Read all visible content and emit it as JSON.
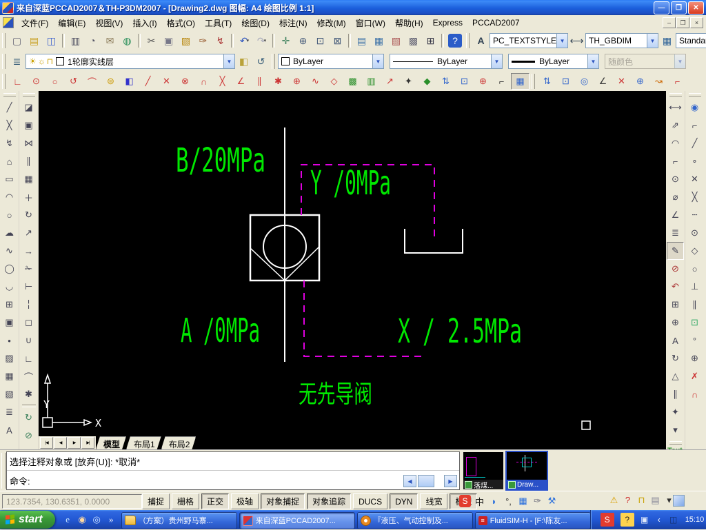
{
  "colors": {
    "cad_green": "#00e800",
    "cad_magenta": "#e000e0",
    "cad_white": "#ffffff",
    "selection_blue": "#2a50c8"
  },
  "title_bar": {
    "title": "来自深蓝PCCAD2007＆TH-P3DM2007 - [Drawing2.dwg 图幅: A4 绘图比例 1:1]",
    "minimize": "—",
    "restore": "❐",
    "close": "✕"
  },
  "menu_bar": {
    "items": [
      {
        "n": "menu-file",
        "t": "文件(F)"
      },
      {
        "n": "menu-edit",
        "t": "编辑(E)"
      },
      {
        "n": "menu-view",
        "t": "视图(V)"
      },
      {
        "n": "menu-insert",
        "t": "插入(I)"
      },
      {
        "n": "menu-format",
        "t": "格式(O)"
      },
      {
        "n": "menu-tools",
        "t": "工具(T)"
      },
      {
        "n": "menu-draw",
        "t": "绘图(D)"
      },
      {
        "n": "menu-dimension",
        "t": "标注(N)"
      },
      {
        "n": "menu-modify",
        "t": "修改(M)"
      },
      {
        "n": "menu-window",
        "t": "窗口(W)"
      },
      {
        "n": "menu-help",
        "t": "帮助(H)"
      },
      {
        "n": "menu-express",
        "t": "Express"
      },
      {
        "n": "menu-pccad",
        "t": "PCCAD2007"
      }
    ],
    "minimize": "–",
    "restore": "❐",
    "close": "×"
  },
  "toolbars": {
    "standard": {
      "items": [
        {
          "n": "new-icon",
          "g": "▢",
          "c": "#667"
        },
        {
          "n": "open-icon",
          "g": "▤",
          "c": "#c9a227"
        },
        {
          "n": "save-icon",
          "g": "◫",
          "c": "#3a5fcd"
        },
        {
          "sep": 1
        },
        {
          "n": "plot-icon",
          "g": "▥",
          "c": "#556"
        },
        {
          "n": "plot-preview-icon",
          "g": "◔",
          "c": "#556"
        },
        {
          "n": "publish-icon",
          "g": "✉",
          "c": "#887755"
        },
        {
          "n": "web-icon",
          "g": "◍",
          "c": "#2a8f5a"
        },
        {
          "sep": 1
        },
        {
          "n": "cut-icon",
          "g": "✂",
          "c": "#555"
        },
        {
          "n": "copy-icon",
          "g": "▣",
          "c": "#778"
        },
        {
          "n": "paste-icon",
          "g": "▨",
          "c": "#b8860b"
        },
        {
          "n": "match-properties-icon",
          "g": "✑",
          "c": "#96592d"
        },
        {
          "n": "block-editor-icon",
          "g": "↯",
          "c": "#a33"
        },
        {
          "sep": 1
        },
        {
          "n": "undo-icon",
          "g": "↶",
          "c": "#2a52be",
          "dd": 1
        },
        {
          "n": "redo-icon",
          "g": "↷",
          "c": "#a8aabb",
          "dd": 1
        },
        {
          "sep": 1
        },
        {
          "n": "pan-icon",
          "g": "✛",
          "c": "#3a7f5a"
        },
        {
          "n": "zoom-realtime-icon",
          "g": "⊕",
          "c": "#445a7a"
        },
        {
          "n": "zoom-window-icon",
          "g": "⊡",
          "c": "#445a7a"
        },
        {
          "n": "zoom-previous-icon",
          "g": "⊠",
          "c": "#445a7a"
        },
        {
          "sep": 1
        },
        {
          "n": "properties-icon",
          "g": "▤",
          "c": "#4477aa"
        },
        {
          "n": "sheet-set-icon",
          "g": "▦",
          "c": "#4477aa"
        },
        {
          "n": "markup-icon",
          "g": "▧",
          "c": "#aa5555"
        },
        {
          "n": "render-icon",
          "g": "▩",
          "c": "#667"
        },
        {
          "n": "calculator-icon",
          "g": "⊞",
          "c": "#334"
        },
        {
          "sep": 1
        },
        {
          "n": "help-icon",
          "g": "?",
          "c": "#fff",
          "bg": "#2b5cc8"
        }
      ],
      "text_style_icon": "A",
      "text_style": "PC_TEXTSTYLE",
      "dim_style_icon": "⟷",
      "dim_style": "TH_GBDIM",
      "table_style_icon": "▦",
      "table_style": "Standard"
    },
    "layers": {
      "manager": [
        {
          "n": "layer-manager-icon",
          "g": "≣",
          "c": "#335a77"
        }
      ],
      "bulb_icon": "☀",
      "freeze_icon": "☼",
      "lock_icon": "⊓",
      "layer_name": "1轮廓实线层",
      "right": [
        {
          "n": "make-object-layer-icon",
          "g": "◧",
          "c": "#b9a23a"
        },
        {
          "n": "layer-previous-icon",
          "g": "↺",
          "c": "#335a77"
        }
      ]
    },
    "properties": {
      "color": "ByLayer",
      "linetype": "ByLayer",
      "lineweight": "ByLayer",
      "plot_style": "随颜色"
    },
    "custom": {
      "group1": [
        {
          "n": "pccad-tool-1-icon",
          "g": "∟",
          "c": "#c33"
        },
        {
          "n": "pccad-tool-2-icon",
          "g": "⊙",
          "c": "#c33"
        },
        {
          "n": "pccad-tool-3-icon",
          "g": "○",
          "c": "#c33"
        },
        {
          "n": "pccad-tool-4-icon",
          "g": "↺",
          "c": "#c33"
        },
        {
          "n": "pccad-tool-5-icon",
          "g": "⌒",
          "c": "#c33"
        },
        {
          "n": "pccad-tool-6-icon",
          "g": "⊜",
          "c": "#cc9900"
        },
        {
          "n": "pccad-tool-7-icon",
          "g": "◧",
          "c": "#3333cc"
        },
        {
          "n": "pccad-tool-8-icon",
          "g": "╱",
          "c": "#c33"
        },
        {
          "n": "pccad-tool-9-icon",
          "g": "✕",
          "c": "#c33"
        },
        {
          "n": "pccad-tool-10-icon",
          "g": "⊗",
          "c": "#c33"
        },
        {
          "n": "pccad-tool-11-icon",
          "g": "∩",
          "c": "#c33"
        },
        {
          "n": "pccad-tool-12-icon",
          "g": "╳",
          "c": "#c33"
        },
        {
          "n": "pccad-tool-13-icon",
          "g": "∠",
          "c": "#c33"
        },
        {
          "n": "pccad-tool-14-icon",
          "g": "∥",
          "c": "#c33"
        },
        {
          "n": "pccad-tool-15-icon",
          "g": "✱",
          "c": "#c33"
        },
        {
          "n": "pccad-tool-16-icon",
          "g": "⊕",
          "c": "#c33"
        },
        {
          "n": "pccad-tool-17-icon",
          "g": "∿",
          "c": "#c33"
        },
        {
          "n": "pccad-tool-18-icon",
          "g": "◇",
          "c": "#c33"
        }
      ],
      "group2": [
        {
          "n": "pccad-tool-19-icon",
          "g": "▩",
          "c": "#2a8f2a"
        },
        {
          "n": "pccad-tool-20-icon",
          "g": "▥",
          "c": "#2a8f2a"
        },
        {
          "n": "pccad-tool-21-icon",
          "g": "↗",
          "c": "#c33"
        },
        {
          "n": "pccad-tool-22-icon",
          "g": "✦",
          "c": "#333"
        },
        {
          "n": "pccad-tool-23-icon",
          "g": "◆",
          "c": "#2a8f2a"
        },
        {
          "n": "pccad-tool-24-icon",
          "g": "⇅",
          "c": "#36c"
        },
        {
          "n": "pccad-tool-25-icon",
          "g": "⊡",
          "c": "#36c"
        },
        {
          "n": "pccad-tool-26-icon",
          "g": "⊕",
          "c": "#c33"
        },
        {
          "n": "pccad-tool-27-icon",
          "g": "⌐",
          "c": "#333"
        },
        {
          "n": "pccad-tool-28-icon",
          "g": "▦",
          "c": "#36c",
          "pressed": 1
        }
      ],
      "group3": [
        {
          "n": "pccad-tool-29-icon",
          "g": "⇅",
          "c": "#36c"
        },
        {
          "n": "pccad-tool-30-icon",
          "g": "⊡",
          "c": "#36c"
        },
        {
          "n": "pccad-tool-31-icon",
          "g": "◎",
          "c": "#36c"
        },
        {
          "n": "pccad-tool-32-icon",
          "g": "∠",
          "c": "#333"
        },
        {
          "n": "pccad-tool-33-icon",
          "g": "✕",
          "c": "#c33"
        },
        {
          "n": "pccad-tool-34-icon",
          "g": "⊕",
          "c": "#36c"
        },
        {
          "n": "pccad-tool-35-icon",
          "g": "↝",
          "c": "#c60"
        },
        {
          "n": "pccad-tool-36-icon",
          "g": "⌐",
          "c": "#c33"
        }
      ]
    },
    "draw": {
      "items": [
        {
          "n": "line-icon",
          "g": "╱"
        },
        {
          "n": "construction-line-icon",
          "g": "╳"
        },
        {
          "n": "polyline-icon",
          "g": "↯"
        },
        {
          "n": "polygon-icon",
          "g": "⌂"
        },
        {
          "n": "rectangle-icon",
          "g": "▭"
        },
        {
          "n": "arc-icon",
          "g": "◠"
        },
        {
          "n": "circle-icon",
          "g": "○"
        },
        {
          "n": "revision-cloud-icon",
          "g": "☁"
        },
        {
          "n": "spline-icon",
          "g": "∿"
        },
        {
          "n": "ellipse-icon",
          "g": "◯"
        },
        {
          "n": "ellipse-arc-icon",
          "g": "◡"
        },
        {
          "n": "insert-block-icon",
          "g": "⊞"
        },
        {
          "n": "make-block-icon",
          "g": "▣"
        },
        {
          "n": "point-icon",
          "g": "•"
        },
        {
          "n": "hatch-icon",
          "g": "▨"
        },
        {
          "n": "gradient-icon",
          "g": "▦"
        },
        {
          "n": "region-icon",
          "g": "▧"
        },
        {
          "n": "table-icon",
          "g": "≣"
        },
        {
          "n": "multiline-text-icon",
          "g": "A"
        }
      ]
    },
    "modify": {
      "items": [
        {
          "n": "erase-icon",
          "g": "◪"
        },
        {
          "n": "copy-object-icon",
          "g": "▣"
        },
        {
          "n": "mirror-icon",
          "g": "⋈"
        },
        {
          "n": "offset-icon",
          "g": "∥"
        },
        {
          "n": "array-icon",
          "g": "▦"
        },
        {
          "n": "move-icon",
          "g": "＋"
        },
        {
          "n": "rotate-icon",
          "g": "↻"
        },
        {
          "n": "scale-icon",
          "g": "↗"
        },
        {
          "n": "stretch-icon",
          "g": "→"
        },
        {
          "n": "trim-icon",
          "g": "✁"
        },
        {
          "n": "extend-icon",
          "g": "⊢"
        },
        {
          "n": "break-point-icon",
          "g": "╎"
        },
        {
          "n": "break-icon",
          "g": "◻"
        },
        {
          "n": "join-icon",
          "g": "∪"
        },
        {
          "n": "chamfer-icon",
          "g": "∟"
        },
        {
          "n": "fillet-icon",
          "g": "⌒"
        },
        {
          "n": "explode-icon",
          "g": "✱"
        },
        {
          "sep": 1
        },
        {
          "n": "orbit-icon",
          "g": "↻",
          "c": "#3a7f5a"
        },
        {
          "n": "swivel-icon",
          "g": "⊘",
          "c": "#3a7f5a"
        },
        {
          "n": "adjust-view-icon",
          "g": "↝",
          "c": "#3a7f5a"
        }
      ]
    },
    "dimension": {
      "items": [
        {
          "n": "dim-linear-icon",
          "g": "⟷"
        },
        {
          "n": "dim-aligned-icon",
          "g": "⇗"
        },
        {
          "n": "dim-arc-icon",
          "g": "◠"
        },
        {
          "n": "dim-ordinate-icon",
          "g": "⌐"
        },
        {
          "n": "dim-radius-icon",
          "g": "⊙"
        },
        {
          "n": "dim-diameter-icon",
          "g": "⌀"
        },
        {
          "n": "dim-angular-icon",
          "g": "∠"
        },
        {
          "n": "dim-quick-icon",
          "g": "≣"
        },
        {
          "n": "dim-leader-icon",
          "g": "✎",
          "pressed": 1
        },
        {
          "n": "dim-tolerance-icon",
          "g": "⊘",
          "c": "#a33"
        },
        {
          "n": "dim-center-icon",
          "g": "↶",
          "c": "#a33"
        },
        {
          "n": "dim-baseline-icon",
          "g": "⊞"
        },
        {
          "n": "dim-continue-icon",
          "g": "⊕"
        },
        {
          "n": "dim-text-icon",
          "g": "A"
        },
        {
          "n": "dim-update-icon",
          "g": "↻"
        },
        {
          "n": "dim-edit-icon",
          "g": "△"
        },
        {
          "n": "dim-parallel-icon",
          "g": "∥"
        },
        {
          "n": "dim-style-icon",
          "g": "✦"
        },
        {
          "n": "dim-more-icon",
          "g": "▾"
        }
      ],
      "text_tool": {
        "n": "text-tool",
        "t": "Text",
        "c": "#2a8f2a"
      },
      "dots_tool": {
        "n": "point-style-icon",
        "g": "∷",
        "c": "#2a8f2a"
      }
    },
    "osnap": {
      "items": [
        {
          "n": "snap-settings-icon",
          "g": "◉",
          "c": "#36c"
        },
        {
          "n": "snap-from-icon",
          "g": "⌐"
        },
        {
          "n": "snap-endpoint-icon",
          "g": "╱"
        },
        {
          "n": "snap-midpoint-icon",
          "g": "∘"
        },
        {
          "n": "snap-intersection-icon",
          "g": "✕"
        },
        {
          "n": "snap-apparent-icon",
          "g": "╳"
        },
        {
          "n": "snap-extension-icon",
          "g": "┄"
        },
        {
          "n": "snap-center-icon",
          "g": "⊙"
        },
        {
          "n": "snap-quadrant-icon",
          "g": "◇"
        },
        {
          "n": "snap-tangent-icon",
          "g": "○"
        },
        {
          "n": "snap-perpendicular-icon",
          "g": "⊥"
        },
        {
          "n": "snap-parallel-icon",
          "g": "∥"
        },
        {
          "n": "snap-insert-icon",
          "g": "⊡",
          "c": "#3a6"
        },
        {
          "n": "snap-node-icon",
          "g": "°"
        },
        {
          "n": "snap-nearest-icon",
          "g": "⊕"
        },
        {
          "n": "snap-none-icon",
          "g": "✗",
          "c": "#c33"
        },
        {
          "n": "snap-magnet-icon",
          "g": "∩",
          "c": "#c33"
        }
      ]
    }
  },
  "canvas": {
    "labels": {
      "port_b": "B/20MPa",
      "port_y": "Y /0MPa",
      "port_a": "A /0MPa",
      "port_x": "X / 2.5MPa",
      "caption": "无先导阀",
      "ucs_x": "X",
      "ucs_y": "Y"
    }
  },
  "layout_tabs": {
    "nav": [
      {
        "n": "tab-first-button",
        "g": "|◀"
      },
      {
        "n": "tab-prev-button",
        "g": "◀"
      },
      {
        "n": "tab-next-button",
        "g": "▶"
      },
      {
        "n": "tab-last-button",
        "g": "▶|"
      }
    ],
    "items": [
      {
        "n": "tab-model",
        "t": "模型",
        "active": 1
      },
      {
        "n": "tab-layout1",
        "t": "布局1"
      },
      {
        "n": "tab-layout2",
        "t": "布局2"
      }
    ]
  },
  "command": {
    "history": "选择注释对象或 [放弃(U)]: *取消*",
    "prompt": "命令:",
    "scroll_left": "◀",
    "scroll_right": "▶"
  },
  "preview_panel": {
    "items": [
      {
        "label": "落煤..."
      },
      {
        "label": "Draw...",
        "selected": 1
      }
    ]
  },
  "status_bar": {
    "coordinates": "123.7354, 130.6351, 0.0000",
    "toggles": [
      {
        "n": "toggle-snap",
        "t": "捕捉"
      },
      {
        "n": "toggle-grid",
        "t": "栅格"
      },
      {
        "n": "toggle-ortho",
        "t": "正交",
        "pressed": 1
      },
      {
        "n": "toggle-polar",
        "t": "极轴"
      },
      {
        "n": "toggle-osnap",
        "t": "对象捕捉",
        "pressed": 1
      },
      {
        "n": "toggle-otrack",
        "t": "对象追踪",
        "pressed": 1
      },
      {
        "n": "toggle-ducs",
        "t": "DUCS"
      },
      {
        "n": "toggle-dyn",
        "t": "DYN",
        "pressed": 1
      },
      {
        "n": "toggle-lineweight",
        "t": "线宽"
      },
      {
        "n": "toggle-model",
        "t": "模型",
        "pressed": 1
      }
    ],
    "ime": [
      {
        "n": "ime-sogou-icon",
        "g": "S",
        "c": "#fff",
        "bg": "#e23b2e"
      },
      {
        "n": "ime-lang-icon",
        "g": "中",
        "c": "#111"
      },
      {
        "n": "ime-shape-icon",
        "g": "◗",
        "c": "#2a6fdd"
      },
      {
        "n": "ime-punct-icon",
        "g": "°,",
        "c": "#333"
      },
      {
        "n": "ime-keyboard-icon",
        "g": "▦",
        "c": "#2a6fdd"
      },
      {
        "n": "ime-hand-icon",
        "g": "✑",
        "c": "#667"
      },
      {
        "n": "ime-tools-icon",
        "g": "⚒",
        "c": "#2a6fdd"
      }
    ],
    "tray": [
      {
        "n": "tray-alert-icon",
        "g": "⚠",
        "c": "#d99f00"
      },
      {
        "n": "tray-help-icon",
        "g": "?",
        "c": "#c22"
      },
      {
        "n": "tray-lock-icon",
        "g": "⊓",
        "c": "#c8a000"
      },
      {
        "n": "tray-doc-icon",
        "g": "▤",
        "c": "#889"
      },
      {
        "n": "tray-expand-icon",
        "g": "▾",
        "c": "#333"
      }
    ]
  },
  "taskbar": {
    "start_label": "start",
    "quick_launch": [
      {
        "n": "ql-ie-icon",
        "g": "e",
        "c": "#bfe0ff"
      },
      {
        "n": "ql-media-icon",
        "g": "◉",
        "c": "#ffd9a0"
      },
      {
        "n": "ql-player-icon",
        "g": "◎",
        "c": "#cfe4ff"
      },
      {
        "n": "ql-more-icon",
        "g": "»",
        "c": "#fff"
      }
    ],
    "tasks": [
      {
        "n": "task-folder",
        "ic": "folder",
        "t": "（方案）贵州野马寨..."
      },
      {
        "n": "task-pccad",
        "ic": "app",
        "t": "来自深蓝PCCAD2007...",
        "active": 1
      },
      {
        "n": "task-media",
        "ic": "media",
        "t": "『液压、气动控制及..."
      },
      {
        "n": "task-fluidsim",
        "ic": "fsim",
        "t": "FluidSIM-H - [F:\\陈友..."
      }
    ],
    "tray": [
      {
        "n": "tray-sogou-icon",
        "g": "S",
        "c": "#fff",
        "bg": "#e23b2e"
      },
      {
        "n": "tray-ime-help-icon",
        "g": "?",
        "c": "#222",
        "bg": "#ffd34e"
      },
      {
        "n": "tray-window-icon",
        "g": "▣",
        "c": "#dfe8fa"
      },
      {
        "n": "tray-chevron-icon",
        "g": "‹",
        "c": "#fff"
      },
      {
        "n": "tray-network-icon",
        "g": "◫",
        "c": "#14306e"
      }
    ],
    "clock": "15:10"
  }
}
